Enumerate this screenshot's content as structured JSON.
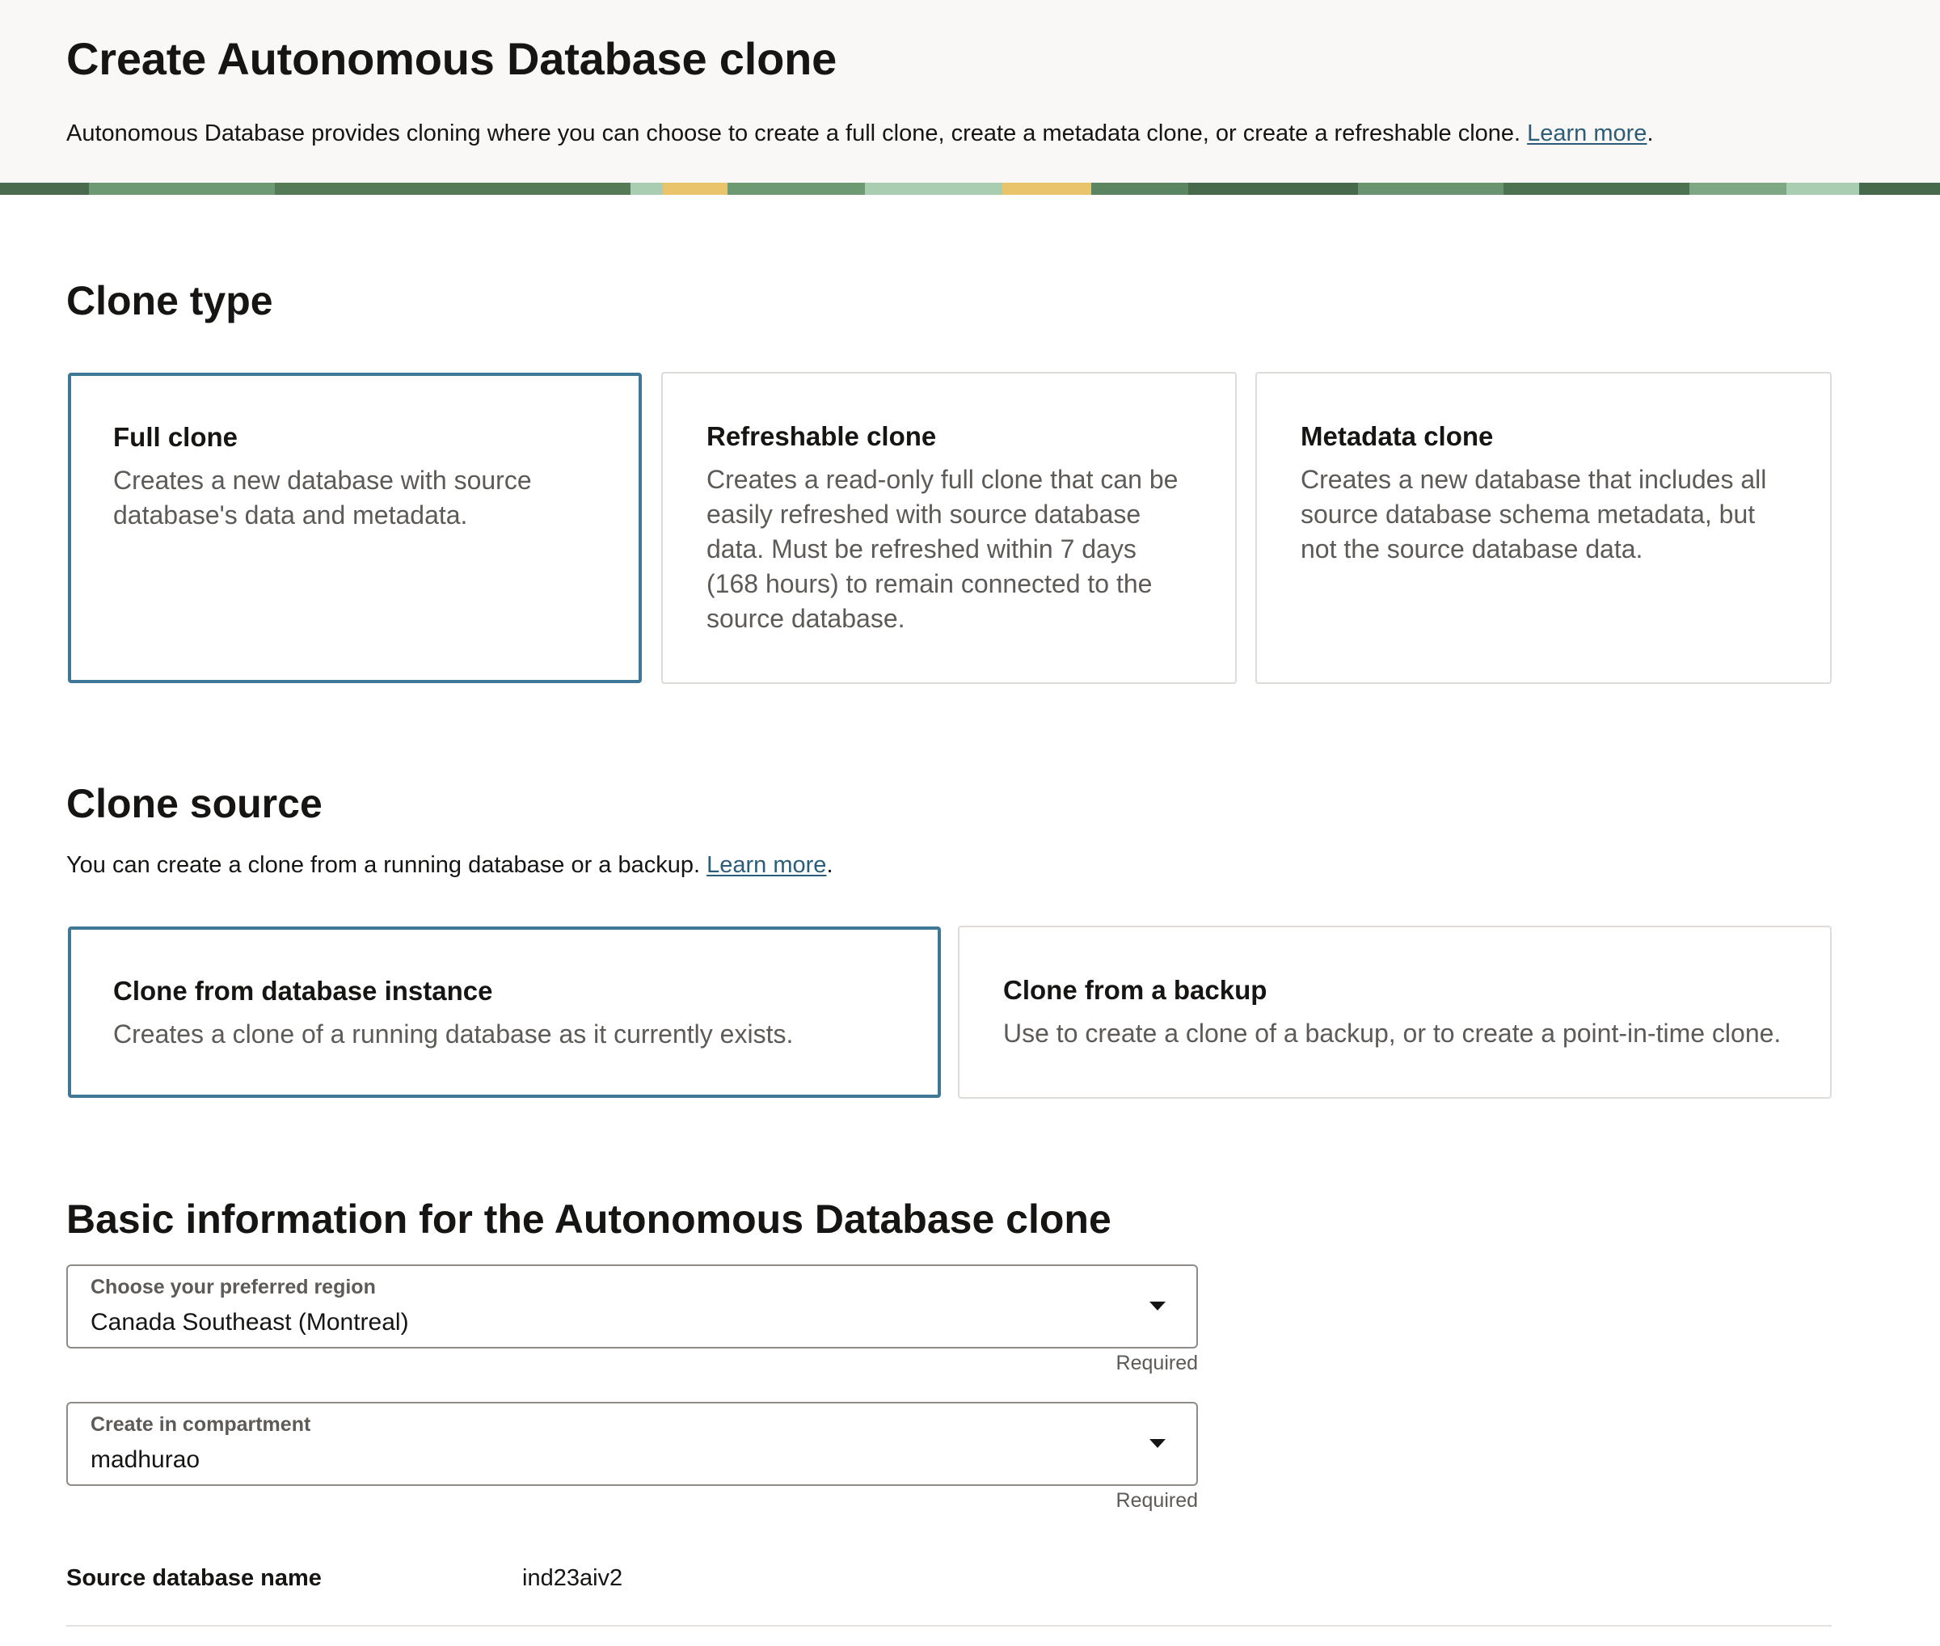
{
  "header": {
    "title": "Create Autonomous Database clone",
    "description": "Autonomous Database provides cloning where you can choose to create a full clone, create a metadata clone, or create a refreshable clone.",
    "learn_more": "Learn more"
  },
  "clone_type": {
    "heading": "Clone type",
    "options": [
      {
        "title": "Full clone",
        "description": "Creates a new database with source database's data and metadata.",
        "selected": true
      },
      {
        "title": "Refreshable clone",
        "description": "Creates a read-only full clone that can be easily refreshed with source database data. Must be refreshed within 7 days (168 hours) to remain connected to the source database.",
        "selected": false
      },
      {
        "title": "Metadata clone",
        "description": "Creates a new database that includes all source database schema metadata, but not the source database data.",
        "selected": false
      }
    ]
  },
  "clone_source": {
    "heading": "Clone source",
    "description": "You can create a clone from a running database or a backup.",
    "learn_more": "Learn more",
    "options": [
      {
        "title": "Clone from database instance",
        "description": "Creates a clone of a running database as it currently exists.",
        "selected": true
      },
      {
        "title": "Clone from a backup",
        "description": "Use to create a clone of a backup, or to create a point-in-time clone.",
        "selected": false
      }
    ]
  },
  "basic_info": {
    "heading": "Basic information for the Autonomous Database clone",
    "region": {
      "label": "Choose your preferred region",
      "value": "Canada Southeast (Montreal)",
      "hint": "Required"
    },
    "compartment": {
      "label": "Create in compartment",
      "value": "madhurao",
      "hint": "Required"
    },
    "source_db": {
      "label": "Source database name",
      "value": "ind23aiv2"
    }
  },
  "colors": {
    "selected_border": "#3e7896",
    "link": "#2b5d78",
    "header_bg": "#f9f8f7"
  }
}
